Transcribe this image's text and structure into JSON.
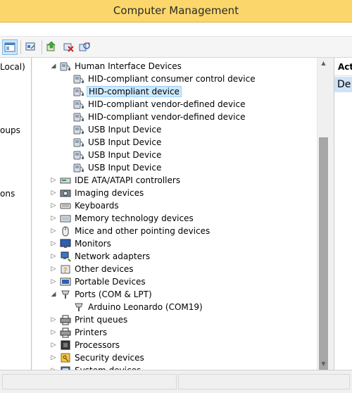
{
  "window": {
    "title": "Computer Management"
  },
  "left_pane": {
    "items": [
      "Local)",
      "oups",
      "ons"
    ]
  },
  "tree": [
    {
      "label": "Human Interface Devices",
      "expander": "open",
      "level": 1,
      "icon": "hid-icon"
    },
    {
      "label": "HID-compliant consumer control device",
      "level": 2,
      "icon": "hid-icon"
    },
    {
      "label": "HID-compliant device",
      "level": 2,
      "icon": "hid-icon",
      "selected": true
    },
    {
      "label": "HID-compliant vendor-defined device",
      "level": 2,
      "icon": "hid-icon"
    },
    {
      "label": "HID-compliant vendor-defined device",
      "level": 2,
      "icon": "hid-icon"
    },
    {
      "label": "USB Input Device",
      "level": 2,
      "icon": "hid-icon"
    },
    {
      "label": "USB Input Device",
      "level": 2,
      "icon": "hid-icon"
    },
    {
      "label": "USB Input Device",
      "level": 2,
      "icon": "hid-icon"
    },
    {
      "label": "USB Input Device",
      "level": 2,
      "icon": "hid-icon"
    },
    {
      "label": "IDE ATA/ATAPI controllers",
      "expander": "closed",
      "level": 1,
      "icon": "ide-icon"
    },
    {
      "label": "Imaging devices",
      "expander": "closed",
      "level": 1,
      "icon": "camera-icon"
    },
    {
      "label": "Keyboards",
      "expander": "closed",
      "level": 1,
      "icon": "keyboard-icon"
    },
    {
      "label": "Memory technology devices",
      "expander": "closed",
      "level": 1,
      "icon": "memory-icon"
    },
    {
      "label": "Mice and other pointing devices",
      "expander": "closed",
      "level": 1,
      "icon": "mouse-icon"
    },
    {
      "label": "Monitors",
      "expander": "closed",
      "level": 1,
      "icon": "monitor-icon"
    },
    {
      "label": "Network adapters",
      "expander": "closed",
      "level": 1,
      "icon": "network-icon"
    },
    {
      "label": "Other devices",
      "expander": "closed",
      "level": 1,
      "icon": "unknown-device-icon"
    },
    {
      "label": "Portable Devices",
      "expander": "closed",
      "level": 1,
      "icon": "portable-device-icon"
    },
    {
      "label": "Ports (COM & LPT)",
      "expander": "open",
      "level": 1,
      "icon": "port-icon"
    },
    {
      "label": "Arduino Leonardo (COM19)",
      "level": 2,
      "icon": "port-icon"
    },
    {
      "label": "Print queues",
      "expander": "closed",
      "level": 1,
      "icon": "printer-icon"
    },
    {
      "label": "Printers",
      "expander": "closed",
      "level": 1,
      "icon": "printer-icon"
    },
    {
      "label": "Processors",
      "expander": "closed",
      "level": 1,
      "icon": "processor-icon"
    },
    {
      "label": "Security devices",
      "expander": "closed",
      "level": 1,
      "icon": "security-icon"
    },
    {
      "label": "System devices",
      "expander": "closed",
      "level": 1,
      "icon": "system-icon"
    }
  ],
  "actions": {
    "header": "Acti",
    "item": "De"
  }
}
